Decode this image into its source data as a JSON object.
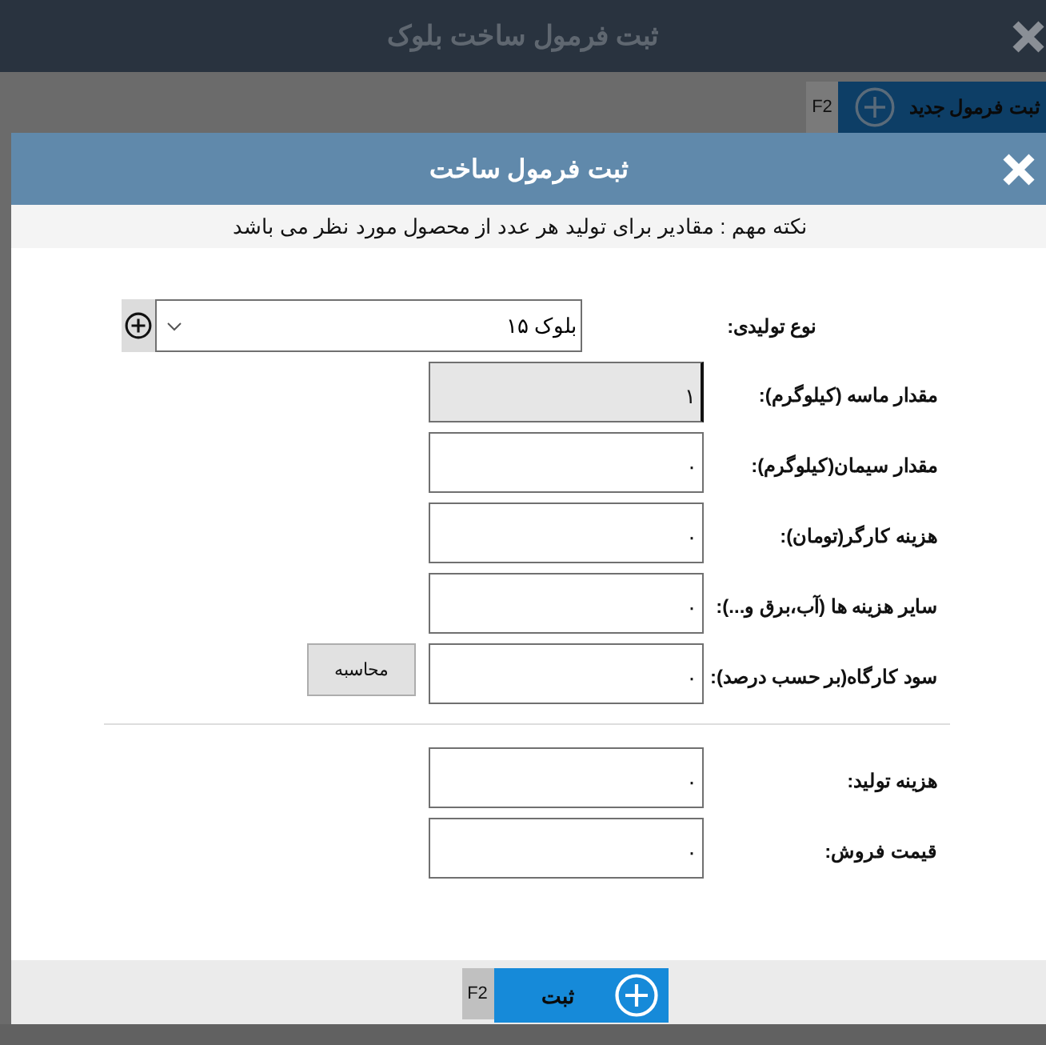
{
  "window": {
    "title": "ثبت فرمول ساخت بلوک"
  },
  "toolbar": {
    "new_button": {
      "label": "ثبت فرمول جدید",
      "shortcut": "F2"
    }
  },
  "dialog": {
    "title": "ثبت فرمول ساخت",
    "note": "نکته مهم : مقادیر برای تولید هر عدد از محصول مورد نظر می باشد",
    "product": {
      "label": "نوع تولیدی:",
      "value": "بلوک ۱۵"
    },
    "fields": [
      {
        "label": "مقدار ماسه (کیلوگرم):",
        "value": "۱",
        "disabled": true
      },
      {
        "label": "مقدار سیمان(کیلوگرم):",
        "value": "۰",
        "disabled": false
      },
      {
        "label": "هزینه کارگر(تومان):",
        "value": "۰",
        "disabled": false
      },
      {
        "label": "سایر هزینه ها (آب،برق و...):",
        "value": "۰",
        "disabled": false
      },
      {
        "label": "سود کارگاه(بر حسب درصد):",
        "value": "۰",
        "disabled": false,
        "button": "محاسبه"
      }
    ],
    "result_fields": [
      {
        "label": "هزینه تولید:",
        "value": "۰"
      },
      {
        "label": "قیمت فروش:",
        "value": "۰"
      }
    ],
    "submit_button": {
      "label": "ثبت",
      "shortcut": "F2"
    }
  }
}
